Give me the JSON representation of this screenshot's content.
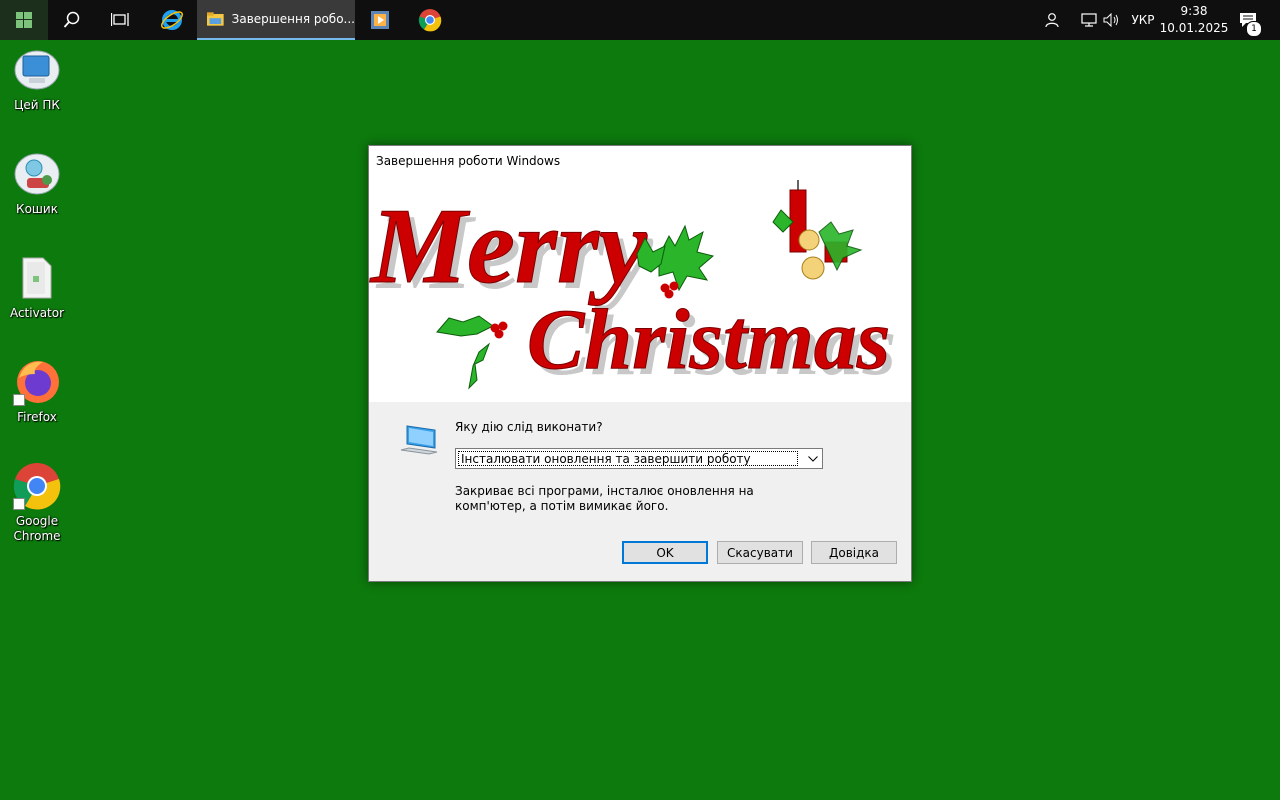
{
  "taskbar": {
    "explorer_label": "Завершення робо...",
    "language": "УКР",
    "time": "9:38",
    "date": "10.01.2025",
    "notifications": "1",
    "icons": [
      "windows-start-icon",
      "search-icon",
      "task-view-icon",
      "internet-explorer-icon",
      "file-explorer-icon",
      "media-player-icon",
      "chrome-icon",
      "people-icon",
      "network-icon",
      "volume-icon",
      "action-center-icon"
    ]
  },
  "desktop": {
    "icons": [
      {
        "label": "Цей ПК"
      },
      {
        "label": "Кошик"
      },
      {
        "label": "Activator"
      },
      {
        "label": "Firefox"
      },
      {
        "label": "Google Chrome"
      }
    ]
  },
  "dialog": {
    "title": "Завершення роботи Windows",
    "banner_line1": "Merry",
    "banner_line2": "Christmas",
    "question": "Яку дію слід виконати?",
    "selected_action": "Інсталювати оновлення та завершити роботу",
    "description": "Закриває всі програми, інсталює оновлення на комп'ютер, а потім вимикає його.",
    "ok_label": "OK",
    "cancel_label": "Скасувати",
    "help_label": "Довідка"
  },
  "colors": {
    "desktop": "#0d7a0d",
    "taskbar": "#0f0f0f",
    "accent": "#0078d7",
    "christmas_red": "#cc0000",
    "holly_green": "#1a9a1a"
  }
}
